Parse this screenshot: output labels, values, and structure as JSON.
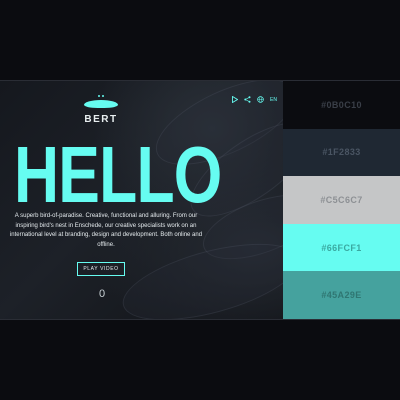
{
  "logo": {
    "text": "BERT"
  },
  "nav": {
    "lang_label": "EN"
  },
  "hero": {
    "heading": "HELLO",
    "description": "A superb bird-of-paradise. Creative, functional and alluring. From our inspiring bird's nest in Enschede, our creative specialists work on an international level at branding, design and development. Both online and offline.",
    "play_label": "PLAY VIDEO",
    "counter": "0"
  },
  "palette": [
    {
      "label": "#0B0C10",
      "color": "#0B0C10"
    },
    {
      "label": "#1F2833",
      "color": "#1F2833"
    },
    {
      "label": "#C5C6C7",
      "color": "#C5C6C7"
    },
    {
      "label": "#66FCF1",
      "color": "#66FCF1"
    },
    {
      "label": "#45A29E",
      "color": "#45A29E"
    }
  ],
  "icons": [
    "play-icon",
    "share-icon",
    "globe-icon"
  ],
  "accent": "#66FCF1"
}
